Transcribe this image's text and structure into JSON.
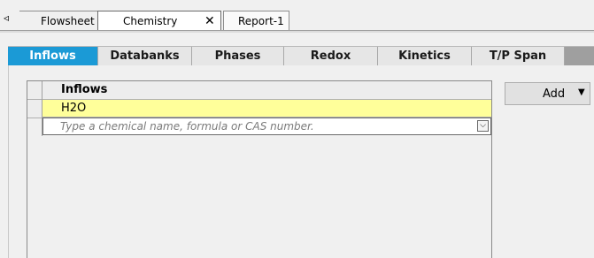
{
  "doc_tabs": {
    "scroll_glyph": "◃",
    "items": [
      {
        "label": "Flowsheet"
      },
      {
        "label": "Chemistry",
        "close": "✕"
      },
      {
        "label": "Report-1"
      }
    ]
  },
  "subtabs": [
    "Inflows",
    "Databanks",
    "Phases",
    "Redox",
    "Kinetics",
    "T/P Span"
  ],
  "active_subtab": "Inflows",
  "grid": {
    "header": "Inflows",
    "rows": [
      "H2O"
    ],
    "input_placeholder": "Type a chemical name, formula or CAS number.",
    "input_value": "",
    "dropdown_glyph": "⌵"
  },
  "add_button": {
    "label": "Add",
    "arrow": "▼"
  },
  "colors": {
    "active_tab": "#1b9ad6",
    "selected_row": "#ffff9a"
  }
}
